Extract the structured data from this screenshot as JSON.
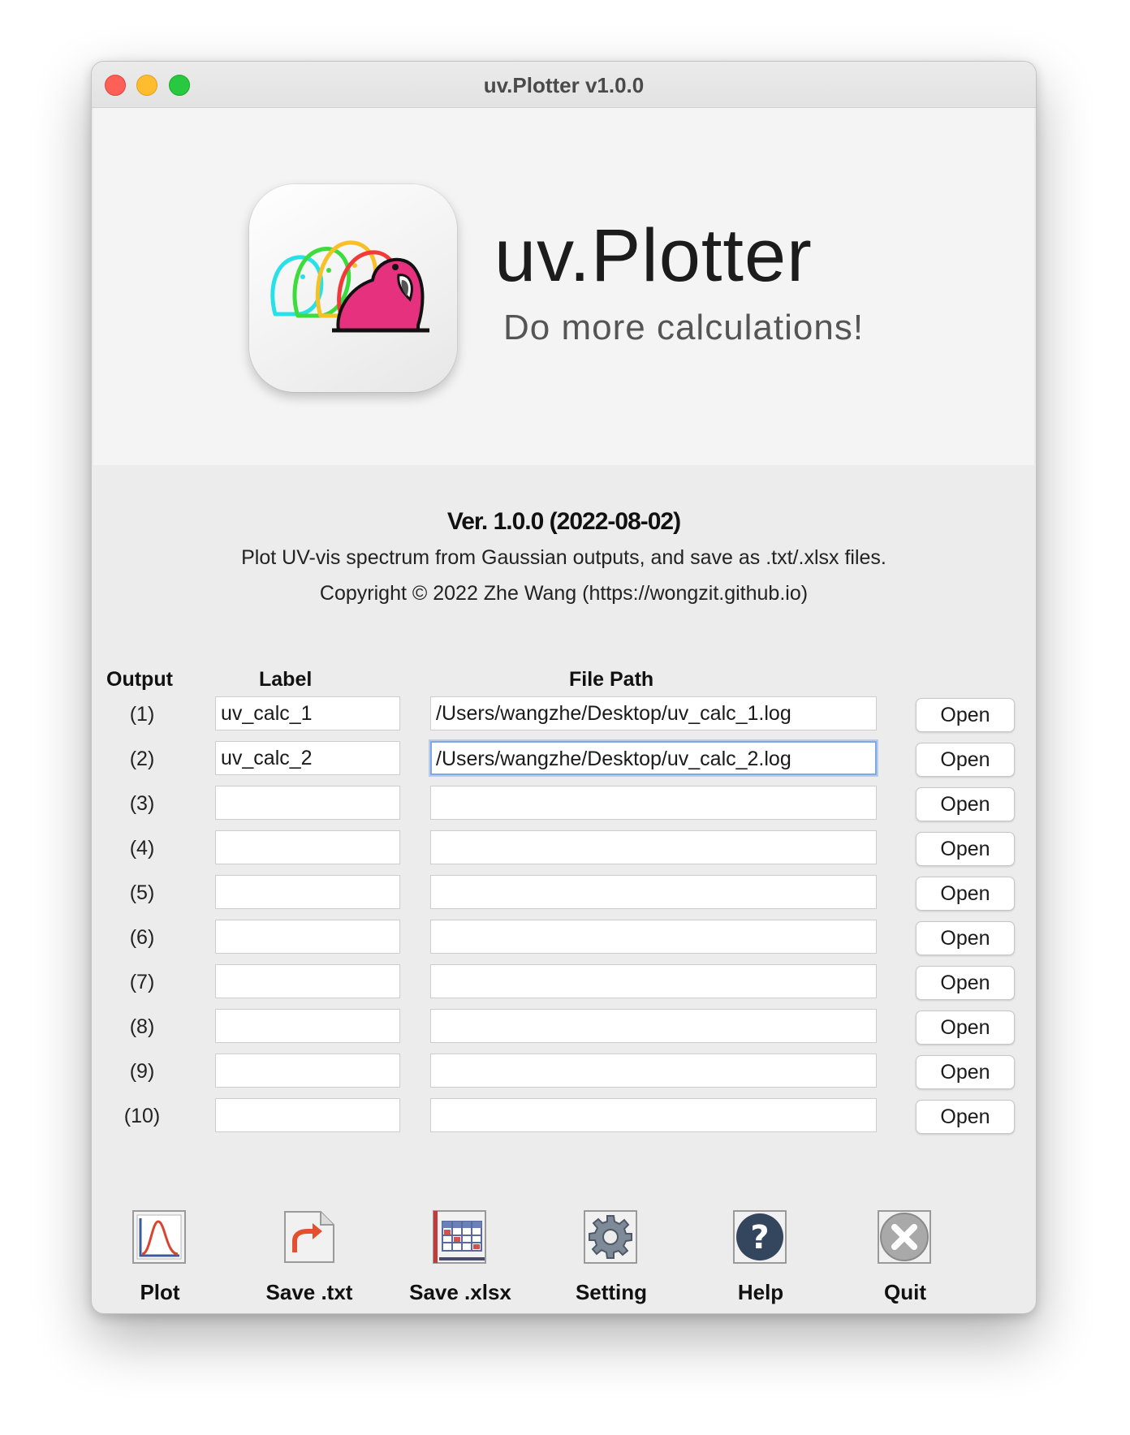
{
  "window": {
    "title": "uv.Plotter v1.0.0"
  },
  "banner": {
    "app_name": "uv.Plotter",
    "tagline": "Do more calculations!",
    "icon": "parrot-logo-icon",
    "accent_colors": [
      "#e6317f",
      "#f23a3a",
      "#f6c026",
      "#3ddc3d",
      "#28e0e8"
    ]
  },
  "about": {
    "version": "Ver. 1.0.0 (2022-08-02)",
    "description": "Plot UV-vis spectrum from Gaussian outputs, and save as .txt/.xlsx files.",
    "copyright": "Copyright © 2022 Zhe Wang (https://wongzit.github.io)"
  },
  "table": {
    "headers": {
      "output": "Output",
      "label": "Label",
      "file_path": "File Path"
    },
    "open_label": "Open",
    "rows": [
      {
        "num": "(1)",
        "label": "uv_calc_1",
        "path": "/Users/wangzhe/Desktop/uv_calc_1.log"
      },
      {
        "num": "(2)",
        "label": "uv_calc_2",
        "path": "/Users/wangzhe/Desktop/uv_calc_2.log"
      },
      {
        "num": "(3)",
        "label": "",
        "path": ""
      },
      {
        "num": "(4)",
        "label": "",
        "path": ""
      },
      {
        "num": "(5)",
        "label": "",
        "path": ""
      },
      {
        "num": "(6)",
        "label": "",
        "path": ""
      },
      {
        "num": "(7)",
        "label": "",
        "path": ""
      },
      {
        "num": "(8)",
        "label": "",
        "path": ""
      },
      {
        "num": "(9)",
        "label": "",
        "path": ""
      },
      {
        "num": "(10)",
        "label": "",
        "path": ""
      }
    ]
  },
  "toolbar": [
    {
      "label": "Plot",
      "icon": "plot-icon"
    },
    {
      "label": "Save .txt",
      "icon": "save-txt-icon"
    },
    {
      "label": "Save .xlsx",
      "icon": "save-xlsx-icon"
    },
    {
      "label": "Setting",
      "icon": "gear-icon"
    },
    {
      "label": "Help",
      "icon": "help-icon"
    },
    {
      "label": "Quit",
      "icon": "quit-icon"
    }
  ]
}
